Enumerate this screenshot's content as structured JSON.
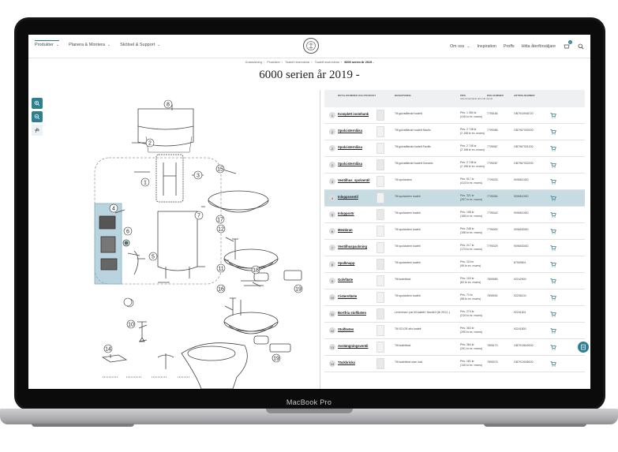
{
  "device": {
    "label": "MacBook Pro"
  },
  "nav": {
    "left": [
      {
        "label": "Produkter"
      },
      {
        "label": "Planera & Montera"
      },
      {
        "label": "Skötsel & Support"
      }
    ],
    "right": [
      {
        "label": "Om oss"
      },
      {
        "label": "Inspiration"
      },
      {
        "label": "Proffs"
      },
      {
        "label": "Hitta återförsäljare"
      }
    ],
    "cart_count": "0",
    "icons": {
      "cart": "cart-icon",
      "search": "search-icon",
      "logo": "brand-seal-icon"
    }
  },
  "breadcrumb": [
    "Gustavsberg",
    "Produkter",
    "Toalett reservdelar",
    "Toalett reservdelar",
    "6000 serien år 2019 -"
  ],
  "title": "6000 serien år 2019 -",
  "zoom": {
    "in": "zoom-in-icon",
    "out": "zoom-out-icon",
    "pan": "hand-icon"
  },
  "diagram": {
    "labels": [
      "8",
      "2",
      "1",
      "3",
      "4",
      "5",
      "6",
      "7",
      "9",
      "10",
      "11",
      "12",
      "13",
      "14",
      "15",
      "16",
      "17",
      "18",
      "19",
      "19"
    ]
  },
  "table": {
    "headers": {
      "name": "Detaljnummer och produkt",
      "desc": "Beskrivning",
      "price": "Pris",
      "price_sub": "rekommenderat pris inkl moms",
      "rsk": "RSK-nummer",
      "art": "Artikelnummer"
    },
    "rows": [
      {
        "n": "1",
        "name": "Komplett inomhank",
        "desc": "Till gulvstående toalett",
        "price": "Pris: 1 350 kr",
        "price2": "(418 kr ex. moms)",
        "rsk": "7795184",
        "art": "GB7910946720"
      },
      {
        "n": "2",
        "name": "Spolcisternlåsa",
        "desc": "Till golvstående toalett Nautic",
        "price": "Pris: 2 748 kr",
        "price2": "(2 198 kr ex. moms)",
        "rsk": "7795366",
        "art": "GB7967030200"
      },
      {
        "n": "2",
        "name": "Spolcisternlåsa",
        "desc": "Till golvstående toalett Pacific",
        "price": "Pris: 2 748 kr",
        "price2": "(2 198 kr ex. moms)",
        "rsk": "7795367",
        "art": "GB7967031200"
      },
      {
        "n": "2",
        "name": "Spolcisternlåsa",
        "desc": "Till golvstående toalett Oceanic",
        "price": "Pris: 2 748 kr",
        "price2": "(2 198 kr ex. moms)",
        "rsk": "7795267",
        "art": "GB7967032200"
      },
      {
        "n": "3",
        "name": "Ventilhus_spolventil",
        "desc": "Till spolcistern",
        "price": "Pris: 517 kr",
        "price2": "(413 kr ex. moms)",
        "rsk": "7795333",
        "art": "9096510DD"
      },
      {
        "n": "4",
        "name": "Inloppsventil",
        "desc": "Till spolcistern toalett",
        "price": "Pris: 321 kr",
        "price2": "(257 kr ex. moms)",
        "rsk": "7795354",
        "art": "9096510DD"
      },
      {
        "n": "5",
        "name": "Inloppsrör",
        "desc": "Till spolcistern toalett",
        "price": "Pris: 198 kr",
        "price2": "(158 kr ex. moms)",
        "rsk": "7795342",
        "art": "9096510DD"
      },
      {
        "n": "6",
        "name": "Membran",
        "desc": "Till spolcistern toalett",
        "price": "Pris: 248 kr",
        "price2": "(198 kr ex. moms)",
        "rsk": "7795300",
        "art": "9096530DD"
      },
      {
        "n": "7",
        "name": "Ventilhuspackning",
        "desc": "Till spolcistern toalett",
        "price": "Pris: 217 kr",
        "price2": "(173 kr ex. moms)",
        "rsk": "7795329",
        "art": "9096530DD"
      },
      {
        "n": "8",
        "name": "Spolknapp",
        "desc": "Till spolcistern toalett",
        "price": "Pris: 119 kr",
        "price2": "(95 kr ex. moms)",
        "rsk": "",
        "art": "87909501"
      },
      {
        "n": "9",
        "name": "Golvfäste",
        "desc": "Till toalettstol",
        "price": "Pris: 103 kr",
        "price2": "(82 kr ex. moms)",
        "rsk": "7895983",
        "art": "92242500"
      },
      {
        "n": "10",
        "name": "Cisternfäste",
        "desc": "Till spolcistern toalett",
        "price": "Pris: 73 kr",
        "price2": "(58 kr ex. moms)",
        "rsk": "7895992",
        "art": "92236100"
      },
      {
        "n": "11",
        "name": "Bortfria stolfästen",
        "desc": "Levereras i par till toalett i Nordic3 (år 2013 -)",
        "price": "Pris: 274 kr",
        "price2": "(219 kr ex. moms)",
        "rsk": "",
        "art": "92241601"
      },
      {
        "n": "12",
        "name": "Stolfästen",
        "desc": "Till SC/GR-ello toalett",
        "price": "Pris: 363 kr",
        "price2": "(290 kr ex. moms)",
        "rsk": "",
        "art": "92241800"
      },
      {
        "n": "13",
        "name": "Avstängningsventil",
        "desc": "Till toalettstol",
        "price": "Pris: 364 kr",
        "price2": "(291 kr ex. moms)",
        "rsk": "7895170",
        "art": "GB7919640000"
      },
      {
        "n": "14",
        "name": "Täckbricka",
        "desc": "Till toalettstol utan lock",
        "price": "Pris: 181 kr",
        "price2": "(145 kr ex. moms)",
        "rsk": "7895374",
        "art": "GB7913008200"
      }
    ]
  },
  "colors": {
    "accent": "#2f7f92",
    "highlight": "#c6dbe2"
  }
}
